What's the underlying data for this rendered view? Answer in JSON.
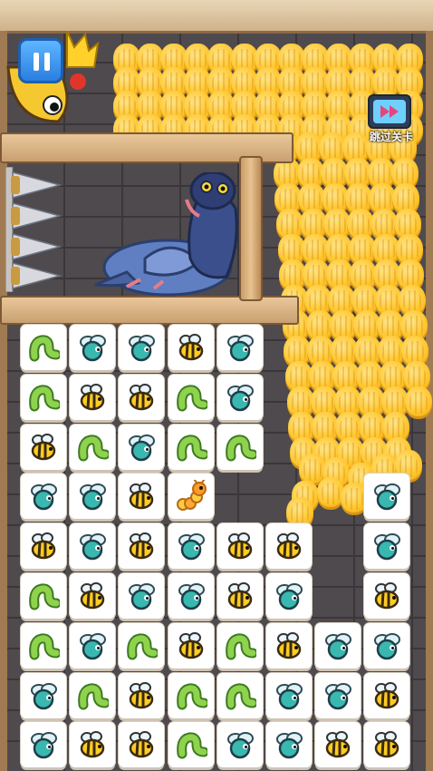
{
  "hud": {
    "pause_icon": "pause-icon",
    "skip_label": "跳过关卡",
    "skip_icon": "video-skip-icon"
  },
  "colors": {
    "wall": "#4e4a4d",
    "wood": "#d9b383",
    "corn": "#ffc62c",
    "tile": "#ffffff",
    "button_blue": "#2a7fe0"
  },
  "characters": [
    "pigeon",
    "king-bird"
  ],
  "board": {
    "rows": [
      [
        "worm",
        "fly",
        "fly",
        "bee",
        "fly",
        null,
        null,
        null
      ],
      [
        "worm",
        "bee",
        "bee",
        "worm",
        "fly",
        null,
        null,
        null
      ],
      [
        "bee",
        "worm",
        "fly",
        "worm",
        "worm",
        null,
        null,
        null
      ],
      [
        "fly",
        "fly",
        "bee",
        "caterpillar",
        null,
        null,
        null,
        "fly"
      ],
      [
        "bee",
        "fly",
        "bee",
        "fly",
        "bee",
        "bee",
        null,
        "fly"
      ],
      [
        "worm",
        "bee",
        "fly",
        "fly",
        "bee",
        "fly",
        null,
        "bee"
      ],
      [
        "worm",
        "fly",
        "worm",
        "bee",
        "worm",
        "bee",
        "fly",
        "fly"
      ],
      [
        "fly",
        "worm",
        "bee",
        "worm",
        "worm",
        "fly",
        "fly",
        "bee"
      ],
      [
        "fly",
        "bee",
        "bee",
        "worm",
        "fly",
        "fly",
        "bee",
        "bee"
      ]
    ]
  }
}
